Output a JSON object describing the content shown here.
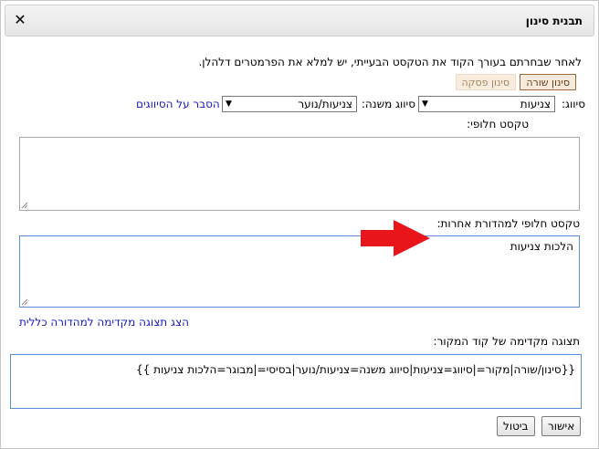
{
  "dialog": {
    "title": "תבנית סינון",
    "close_label": "✕"
  },
  "intro": "לאחר שבחרתם בעורך הקוד את הטקסט הבעייתי, יש למלא את הפרמטרים דלהלן.",
  "template_buttons": {
    "line": "סינון שורה",
    "paragraph": "סינון פסקה"
  },
  "classification": {
    "label": "סיווג:",
    "value": "צניעות",
    "sub_label": "סיווג משנה:",
    "sub_value": "צניעות/נוער",
    "help_link": "הסבר על הסיווגים"
  },
  "alt_text": {
    "label": "טקסט חלופי:",
    "value": ""
  },
  "alt_text_other": {
    "label": "טקסט חלופי למהדורת אחרות:",
    "value": "הלכות צניעות"
  },
  "preview_link": "הצג תצוגה מקדימה למהדורה כללית",
  "source_preview": {
    "label": "תצוגה מקדימה של קוד המקור:",
    "value": "{{סינון/שורה|מקור=|סיווג=צניעות|סיווג משנה=צניעות/נוער|בסיסי=|מבוגר=הלכות צניעות }}"
  },
  "buttons": {
    "ok": "אישור",
    "cancel": "ביטול"
  },
  "colors": {
    "annotation_arrow": "#e8161b",
    "link": "#1a1ab8",
    "focus_border": "#5b8ed6"
  }
}
